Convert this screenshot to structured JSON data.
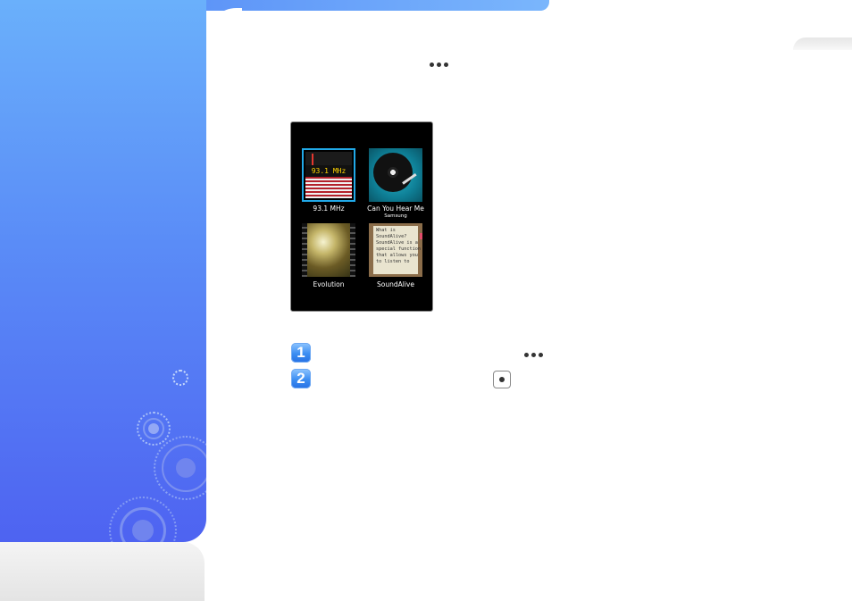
{
  "device_screen": {
    "tiles": [
      {
        "caption": "93.1 MHz",
        "art_text": "93.1 MHz",
        "icon": "fm-radio-icon"
      },
      {
        "caption": "Can You Hear Me",
        "subcaption": "Samsung",
        "icon": "vinyl-record-icon"
      },
      {
        "caption": "Evolution",
        "icon": "film-icon"
      },
      {
        "caption": "SoundAlive",
        "art_text": "What is\nSoundAlive?\nSoundAlive is a\nspecial function\nthat allows you\nto listen to",
        "icon": "book-icon"
      }
    ]
  },
  "steps": [
    {
      "number": "1",
      "inline_icon": "more-options-icon"
    },
    {
      "number": "2",
      "inline_icon": "select-button-icon"
    }
  ],
  "header": {
    "inline_icon": "more-options-icon"
  },
  "colors": {
    "sidebar_top": "#6ab0fb",
    "sidebar_bottom": "#4e63f1",
    "selection": "#21a9e8",
    "step_badge": "#3c8ef2"
  }
}
